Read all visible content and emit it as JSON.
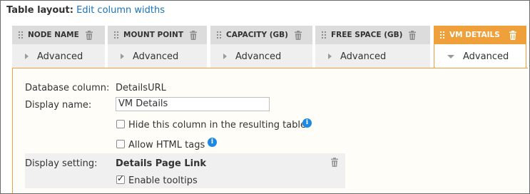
{
  "header": {
    "label": "Table layout:",
    "link": "Edit column widths"
  },
  "columns": [
    {
      "title": "NODE NAME",
      "advanced": "Advanced",
      "active": false
    },
    {
      "title": "MOUNT POINT",
      "advanced": "Advanced",
      "active": false
    },
    {
      "title": "CAPACITY (GB)",
      "advanced": "Advanced",
      "active": false
    },
    {
      "title": "FREE SPACE (GB)",
      "advanced": "Advanced",
      "active": false
    },
    {
      "title": "VM DETAILS",
      "advanced": "Advanced",
      "active": true
    }
  ],
  "details": {
    "db_label": "Database column:",
    "db_value": "DetailsURL",
    "display_name_label": "Display name:",
    "display_name_value": "VM Details",
    "hide_label": "Hide this column in the resulting table",
    "hide_checked": false,
    "html_label": "Allow HTML tags",
    "html_checked": false,
    "setting_label": "Display setting:",
    "setting_value": "Details Page Link",
    "tooltips_label": "Enable tooltips",
    "tooltips_checked": true
  },
  "colors": {
    "accent": "#f0a03a",
    "link": "#1a73b8",
    "info": "#1e88e5"
  }
}
